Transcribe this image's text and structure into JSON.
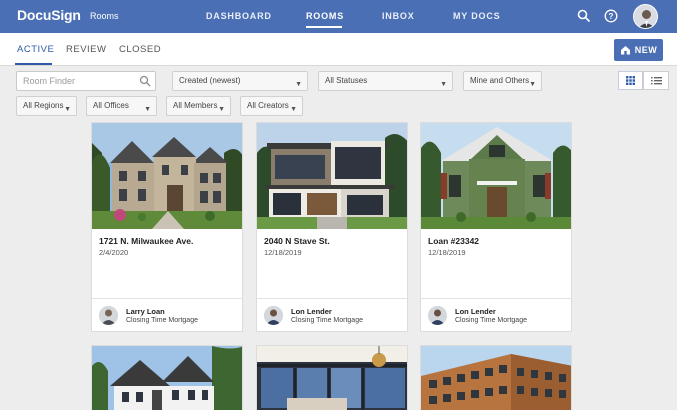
{
  "app": {
    "logo": "DocuSign",
    "section": "Rooms"
  },
  "nav": {
    "items": [
      {
        "label": "DASHBOARD"
      },
      {
        "label": "ROOMS"
      },
      {
        "label": "INBOX"
      },
      {
        "label": "MY DOCS"
      }
    ],
    "active": "ROOMS"
  },
  "tabs": [
    {
      "label": "ACTIVE"
    },
    {
      "label": "REVIEW"
    },
    {
      "label": "CLOSED"
    }
  ],
  "new_button": {
    "label": "NEW"
  },
  "filters": {
    "search_placeholder": "Room Finder",
    "sort": "Created (newest)",
    "status": "All Statuses",
    "ownership": "Mine and Others",
    "regions": "All Regions",
    "offices": "All Offices",
    "members": "All Members",
    "creators": "All Creators"
  },
  "rooms": [
    {
      "title": "1721 N. Milwaukee Ave.",
      "date": "2/4/2020",
      "owner": "Larry Loan",
      "org": "Closing Time Mortgage"
    },
    {
      "title": "2040 N Stave St.",
      "date": "12/18/2019",
      "owner": "Lon Lender",
      "org": "Closing Time Mortgage"
    },
    {
      "title": "Loan #23342",
      "date": "12/18/2019",
      "owner": "Lon Lender",
      "org": "Closing Time Mortgage"
    }
  ],
  "colors": {
    "brand": "#4b6fb5",
    "accent": "#2e5aac",
    "background": "#ededed"
  }
}
